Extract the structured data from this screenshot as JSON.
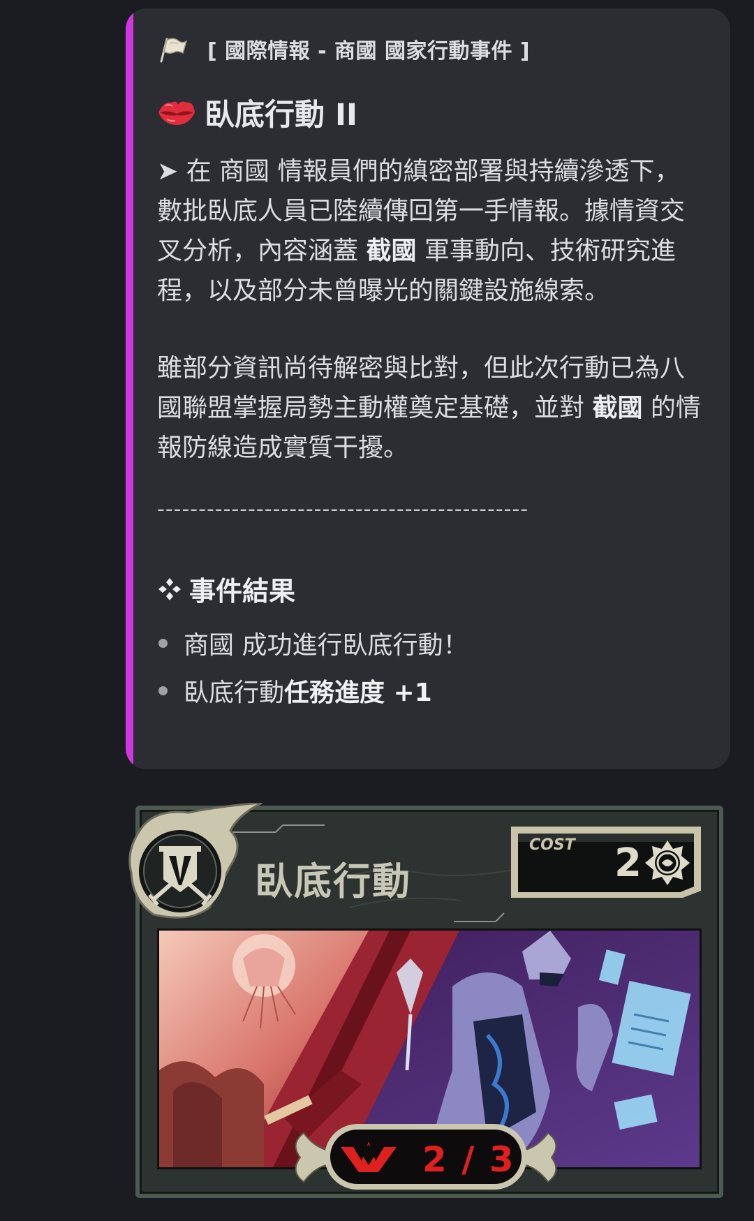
{
  "embed": {
    "accent_color": "#d336e0",
    "header_icon": "flag-icon",
    "header": "[ 國際情報 - 商國 國家行動事件 ]",
    "title_icon": "lips-icon",
    "title": "臥底行動 II",
    "para1": {
      "p1": "➤ 在 商國 情報員們的縝密部署與持續滲透下，數批臥底人員已陸續傳回第一手情報。據情資交叉分析，內容涵蓋 ",
      "b1": "截國",
      "p2": " 軍事動向、技術研究進程，以及部分未曾曝光的關鍵設施線索。"
    },
    "para2": {
      "p1": "雖部分資訊尚待解密與比對，但此次行動已為八國聯盟掌握局勢主動權奠定基礎，並對 ",
      "b1": "截國",
      "p2": " 的情報防線造成實質干擾。"
    },
    "divider": "---------------------------------------------",
    "results_icon": "four-diamonds-icon",
    "results_title": "事件結果",
    "results": {
      "item1": "商國 成功進行臥底行動！",
      "item2_plain": "臥底行動 ",
      "item2_bold": "任務進度 +1"
    }
  },
  "card": {
    "emblem_icon": "shield-banner-swords-icon",
    "title": "臥底行動",
    "cost_label": "COST",
    "cost_value": "2",
    "cost_icon": "sun-medallion-icon",
    "progress_icon": "red-crown-icon",
    "progress": "2 / 3",
    "progress_color": "#e0201e"
  }
}
